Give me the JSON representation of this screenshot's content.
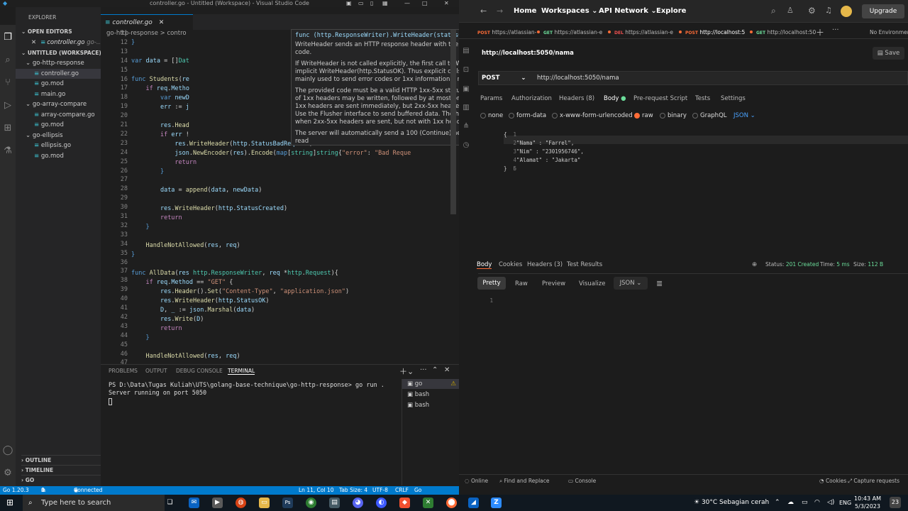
{
  "vscode": {
    "window_title": "controller.go - Untitled (Workspace) - Visual Studio Code",
    "explorer_label": "EXPLORER",
    "open_editors_label": "OPEN EDITORS",
    "open_editor_file": "controller.go",
    "open_editor_hint": "go-...",
    "workspace_label": "UNTITLED (WORKSPACE)",
    "tree": [
      {
        "label": "go-http-response",
        "type": "folder",
        "color": "#cccccc"
      },
      {
        "label": "controller.go",
        "type": "file",
        "color": "#cccccc",
        "selected": true
      },
      {
        "label": "go.mod",
        "type": "file",
        "color": "#cccccc"
      },
      {
        "label": "main.go",
        "type": "file",
        "color": "#cccccc"
      },
      {
        "label": "go-array-compare",
        "type": "folder",
        "color": "#cccccc"
      },
      {
        "label": "array-compare.go",
        "type": "file",
        "color": "#cccccc"
      },
      {
        "label": "go.mod",
        "type": "file",
        "color": "#cccccc"
      },
      {
        "label": "go-ellipsis",
        "type": "folder",
        "color": "#cccccc"
      },
      {
        "label": "ellipsis.go",
        "type": "file",
        "color": "#cccccc"
      },
      {
        "label": "go.mod",
        "type": "file",
        "color": "#cccccc"
      }
    ],
    "outline_label": "OUTLINE",
    "timeline_label": "TIMELINE",
    "go_label": "GO",
    "active_tab": "controller.go",
    "breadcrumb": "go-http-response > contro",
    "hover": {
      "signature": "func (http.ResponseWriter).WriteHeader(statusCode int)",
      "p1": "WriteHeader sends an HTTP response header with the provided status code.",
      "p2": "If WriteHeader is not called explicitly, the first call to Write will trigger an implicit WriteHeader(http.StatusOK). Thus explicit calls to WriteHeader are mainly used to send error codes or 1xx informational responses.",
      "p3": "The provided code must be a valid HTTP 1xx-5xx status code. Any number of 1xx headers may be written, followed by at most one 2xx-5xx header. 1xx headers are sent immediately, but 2xx-5xx headers may be buffered. Use the Flusher interface to send buffered data. The header map is cleared when 2xx-5xx headers are sent, but not with 1xx headers.",
      "p4": "The server will automatically send a 100 (Continue) header on the first read"
    },
    "line_numbers": [
      "11",
      "12",
      "13",
      "14",
      "15",
      "16",
      "17",
      "18",
      "19",
      "20",
      "21",
      "22",
      "23",
      "24",
      "25",
      "26",
      "27",
      "28",
      "29",
      "30",
      "31",
      "32",
      "33",
      "34",
      "35",
      "36",
      "37",
      "38",
      "39",
      "40",
      "41",
      "42",
      "43",
      "44",
      "45",
      "46",
      "47"
    ],
    "panel_tabs": [
      "PROBLEMS",
      "OUTPUT",
      "DEBUG CONSOLE",
      "TERMINAL"
    ],
    "terminal_lines": [
      "PS D:\\Data\\Tugas Kuliah\\UTS\\golang-base-technique\\go-http-response> go run .",
      "Server running on port 5050"
    ],
    "terminal_list": [
      "go",
      "bash",
      "bash"
    ],
    "status": {
      "left": "Go 1.20.3",
      "errors": "0",
      "warnings": "0",
      "connected": "Connected to Discord",
      "position": "Ln 11, Col 10",
      "tab_size": "Tab Size: 4",
      "encoding": "UTF-8",
      "eol": "CRLF",
      "lang": "Go"
    }
  },
  "postman": {
    "nav": [
      "Home",
      "Workspaces",
      "API Network",
      "Explore"
    ],
    "upgrade": "Upgrade",
    "tabs": [
      {
        "method": "POST",
        "url": "https://atlassian-"
      },
      {
        "method": "GET",
        "url": "https://atlassian-e"
      },
      {
        "method": "DEL",
        "url": "https://atlassian-e"
      },
      {
        "method": "POST",
        "url": "http://localhost:5"
      },
      {
        "method": "GET",
        "url": "http://localhost:50"
      }
    ],
    "environment": "No Environmen",
    "request_name": "http://localhost:5050/nama",
    "save_label": "Save",
    "method": "POST",
    "url": "http://localhost:5050/nama",
    "req_tabs": [
      "Params",
      "Authorization",
      "Headers (8)",
      "Body",
      "Pre-request Script",
      "Tests",
      "Settings"
    ],
    "body_types": [
      "none",
      "form-data",
      "x-www-form-urlencoded",
      "raw",
      "binary",
      "GraphQL"
    ],
    "body_format": "JSON",
    "body_lines": [
      "{",
      "    \"Nama\" : \"Farrel\",",
      "    \"Nim\" : \"2301956746\",",
      "    \"Alamat\" : \"Jakarta\"",
      "}",
      ""
    ],
    "body_line_numbers": [
      "1",
      "2",
      "3",
      "4",
      "5",
      "6"
    ],
    "resp_tabs": [
      "Body",
      "Cookies",
      "Headers (3)",
      "Test Results"
    ],
    "status_label": "Status:",
    "status_value": "201 Created",
    "time_label": "Time:",
    "time_value": "5 ms",
    "size_label": "Size:",
    "size_value": "112 B",
    "view_modes": [
      "Pretty",
      "Raw",
      "Preview",
      "Visualize"
    ],
    "resp_format": "JSON",
    "resp_line": "1",
    "bottom": [
      "Online",
      "Find and Replace",
      "Console",
      "Cookies",
      "Capture requests"
    ]
  },
  "taskbar": {
    "search_placeholder": "Type here to search",
    "weather": "30°C Sebagian cerah",
    "lang": "ENG",
    "time": "10:43 AM",
    "date": "5/3/2023",
    "notif_count": "23"
  }
}
